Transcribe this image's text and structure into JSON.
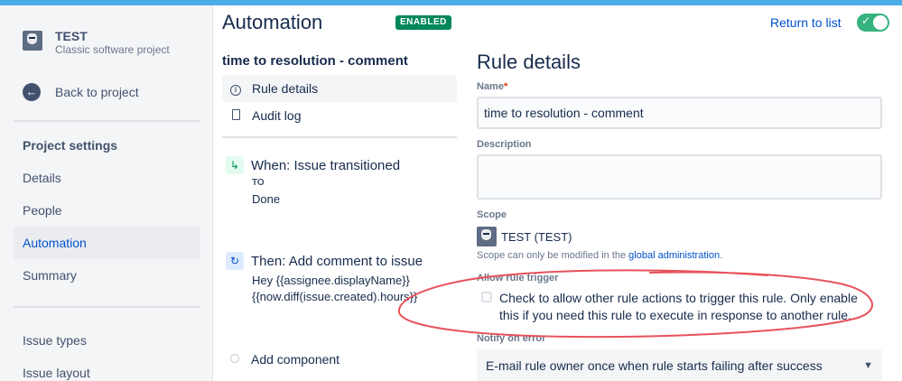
{
  "project": {
    "name": "TEST",
    "type": "Classic software project"
  },
  "sidebar": {
    "back_label": "Back to project",
    "heading": "Project settings",
    "items": [
      {
        "label": "Details"
      },
      {
        "label": "People"
      },
      {
        "label": "Automation",
        "active": true
      },
      {
        "label": "Summary"
      },
      {
        "label": "Issue types"
      },
      {
        "label": "Issue layout"
      }
    ]
  },
  "header": {
    "title": "Automation",
    "status_badge": "ENABLED",
    "return_link": "Return to list",
    "toggle_on": true
  },
  "rule": {
    "name": "time to resolution - comment",
    "nav": [
      {
        "label": "Rule details",
        "icon": "info-icon",
        "active": true
      },
      {
        "label": "Audit log",
        "icon": "document-icon"
      }
    ],
    "trigger": {
      "title": "When: Issue transitioned",
      "to_label": "TO",
      "to_value": "Done"
    },
    "action": {
      "title": "Then: Add comment to issue",
      "line1": "Hey {{assignee.displayName}}",
      "line2": "{{now.diff(issue.created).hours}}"
    },
    "add_component": "Add component"
  },
  "details": {
    "title": "Rule details",
    "name_label": "Name",
    "required_marker": "*",
    "name_value": "time to resolution - comment",
    "description_label": "Description",
    "description_value": "",
    "scope_label": "Scope",
    "scope_value": "TEST (TEST)",
    "scope_note": "Scope can only be modified in the ",
    "scope_note_link": "global administration",
    "scope_note_end": ".",
    "allow_trigger_label": "Allow rule trigger",
    "allow_trigger_text": "Check to allow other rule actions to trigger this rule. Only enable this if you need this rule to execute in response to another rule.",
    "allow_trigger_checked": false,
    "notify_label": "Notify on error",
    "notify_value": "E-mail rule owner once when rule starts failing after success"
  },
  "colors": {
    "top_bar": "#4bade8",
    "accent": "#0052cc",
    "enabled": "#00875a",
    "toggle": "#36b37e",
    "annotation": "#e8525a"
  }
}
